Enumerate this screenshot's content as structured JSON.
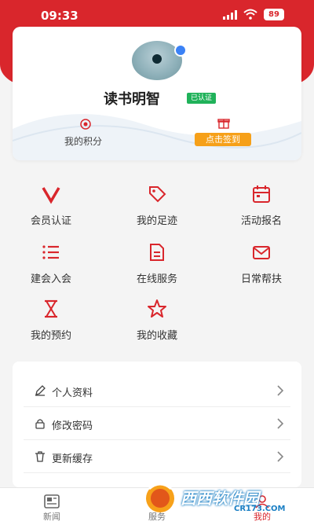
{
  "status_bar": {
    "time": "09:33",
    "battery": "89",
    "icons": [
      "signal-icon",
      "wifi-icon",
      "battery-icon"
    ]
  },
  "profile": {
    "username": "读书明智",
    "verified_tag": "已认证",
    "points_label": "我的积分",
    "signin_button": "点击签到",
    "avatar_icon": "avatar",
    "gender_icon": "male-icon"
  },
  "grid": [
    {
      "label": "会员认证",
      "icon": "v-icon"
    },
    {
      "label": "我的足迹",
      "icon": "tag-icon"
    },
    {
      "label": "活动报名",
      "icon": "calendar-icon"
    },
    {
      "label": "建会入会",
      "icon": "list-icon"
    },
    {
      "label": "在线服务",
      "icon": "document-icon"
    },
    {
      "label": "日常帮扶",
      "icon": "mail-icon"
    },
    {
      "label": "我的预约",
      "icon": "hourglass-icon"
    },
    {
      "label": "我的收藏",
      "icon": "star-icon"
    }
  ],
  "settings": [
    {
      "label": "个人资料",
      "icon": "edit-icon"
    },
    {
      "label": "修改密码",
      "icon": "lock-icon"
    },
    {
      "label": "更新缓存",
      "icon": "trash-icon"
    }
  ],
  "tabbar": [
    {
      "label": "新闻",
      "icon": "news-icon",
      "active": false
    },
    {
      "label": "服务",
      "icon": "service-icon",
      "active": false
    },
    {
      "label": "我的",
      "icon": "user-icon",
      "active": true
    }
  ],
  "watermark": {
    "brand": "西西软件园",
    "domain": "CR173.COM"
  },
  "colors": {
    "accent": "#d9262c",
    "verified": "#20b25a",
    "signin": "#f6a019"
  }
}
